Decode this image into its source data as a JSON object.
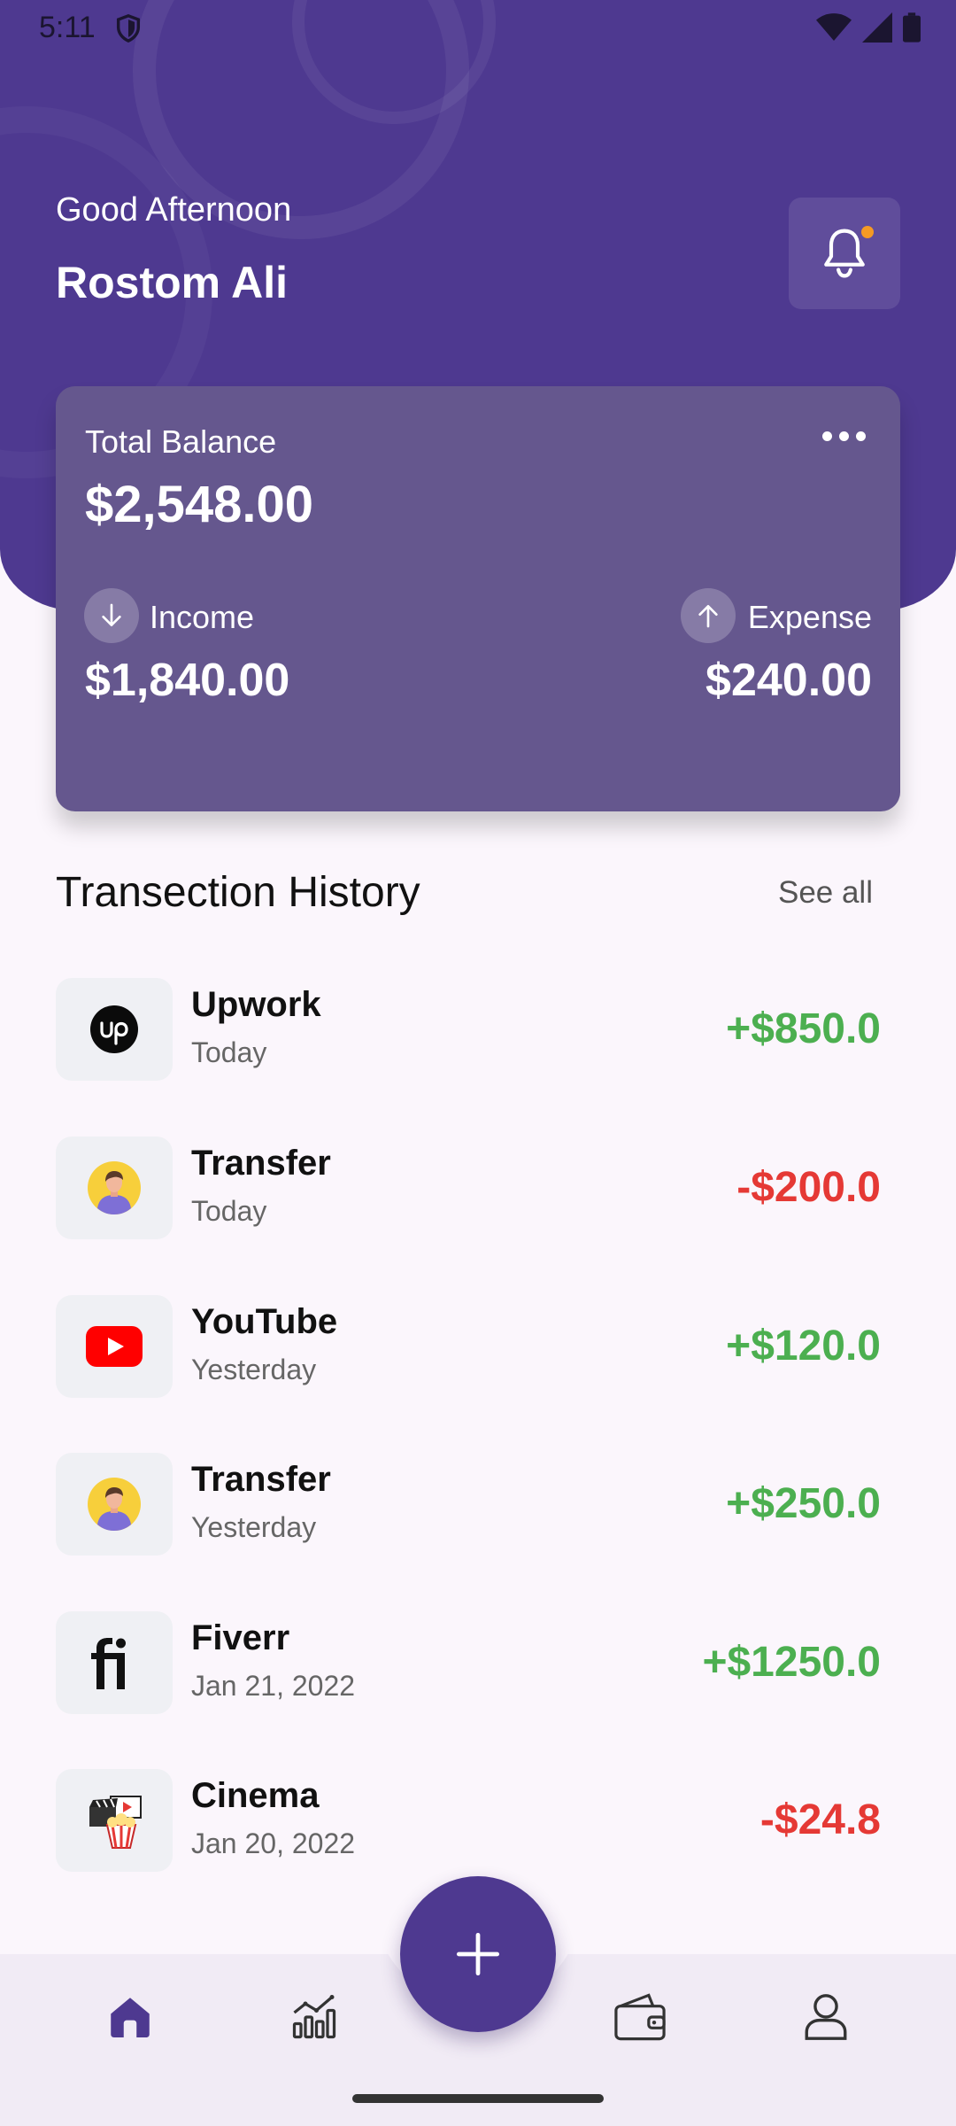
{
  "status_bar": {
    "time": "5:11"
  },
  "header": {
    "greeting": "Good Afternoon",
    "user_name": "Rostom Ali"
  },
  "balance_card": {
    "total_label": "Total Balance",
    "total_value": "$2,548.00",
    "income_label": "Income",
    "income_value": "$1,840.00",
    "expense_label": "Expense",
    "expense_value": "$240.00"
  },
  "history": {
    "title": "Transection History",
    "see_all": "See all",
    "items": [
      {
        "name": "Upwork",
        "date": "Today",
        "amount": "+$850.0",
        "icon": "upwork-logo"
      },
      {
        "name": "Transfer",
        "date": "Today",
        "amount": "-$200.0",
        "icon": "person-avatar"
      },
      {
        "name": "YouTube",
        "date": "Yesterday",
        "amount": "+$120.0",
        "icon": "youtube-logo"
      },
      {
        "name": "Transfer",
        "date": "Yesterday",
        "amount": "+$250.0",
        "icon": "person-avatar"
      },
      {
        "name": "Fiverr",
        "date": "Jan 21, 2022",
        "amount": "+$1250.0",
        "icon": "fiverr-logo"
      },
      {
        "name": "Cinema",
        "date": "Jan 20, 2022",
        "amount": "-$24.8",
        "icon": "cinema-icon"
      }
    ]
  },
  "colors": {
    "primary": "#4e3990",
    "card": "#65578e",
    "positive": "#4caf50",
    "negative": "#e53935",
    "notification_dot": "#f59a23"
  },
  "nav": {
    "items": [
      "home-icon",
      "chart-icon",
      "add-icon",
      "wallet-icon",
      "profile-icon"
    ],
    "active": "home-icon"
  }
}
